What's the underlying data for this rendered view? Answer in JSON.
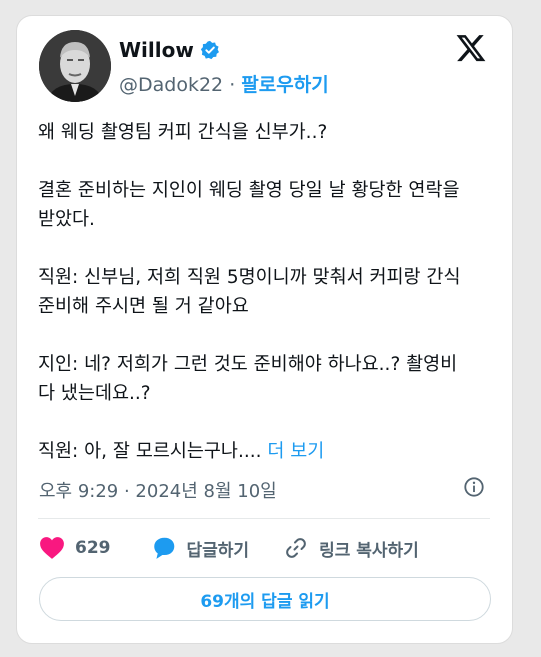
{
  "author": {
    "name": "Willow",
    "handle": "@Dadok22",
    "separator": "·",
    "follow_label": "팔로우하기"
  },
  "tweet": {
    "paragraphs": [
      "왜 웨딩 촬영팀 커피 간식을 신부가..?",
      "결혼 준비하는 지인이 웨딩 촬영 당일 날 황당한 연락을\n받았다.",
      "직원: 신부님, 저희 직원 5명이니까 맞춰서 커피랑 간식\n준비해 주시면 될 거 같아요",
      "지인: 네? 저희가 그런 것도 준비해야 하나요..? 촬영비\n다 냈는데요..?"
    ],
    "last_paragraph": "직원: 아, 잘 모르시는구나.... ",
    "more_label": "더 보기"
  },
  "timestamp": "오후 9:29 · 2024년 8월 10일",
  "actions": {
    "like_count": "629",
    "reply_label": "답글하기",
    "copy_link_label": "링크 복사하기"
  },
  "read_replies_label": "69개의 답글 읽기",
  "colors": {
    "accent": "#1d9bf0",
    "like": "#f91880",
    "text": "#0f1419",
    "muted": "#536471"
  },
  "icons": {
    "verified": "verified-badge-icon",
    "brand": "x-logo-icon",
    "info": "info-icon",
    "like": "heart-icon",
    "reply": "reply-bubble-icon",
    "link": "link-icon"
  }
}
